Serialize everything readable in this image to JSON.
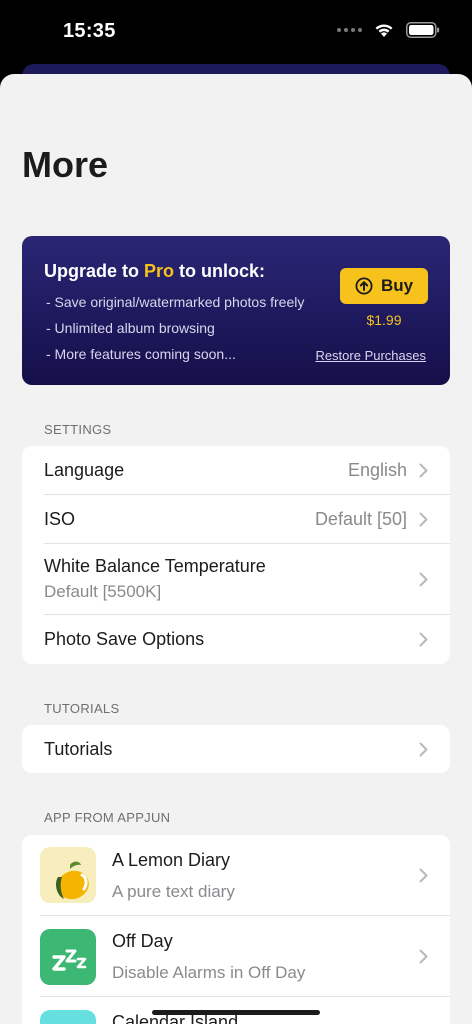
{
  "status": {
    "time": "15:35"
  },
  "page": {
    "title": "More"
  },
  "pro": {
    "heading_pre": "Upgrade to ",
    "heading_pro": "Pro",
    "heading_post": " to unlock:",
    "features": [
      "- Save original/watermarked photos freely",
      "- Unlimited album browsing",
      "- More features coming soon..."
    ],
    "buy_label": "Buy",
    "price": "$1.99",
    "restore_label": "Restore Purchases",
    "accent_color": "#f6c21b",
    "card_color": "#1d1a5c"
  },
  "settings": {
    "header": "SETTINGS",
    "language": {
      "label": "Language",
      "value": "English"
    },
    "iso": {
      "label": "ISO",
      "value": "Default [50]"
    },
    "white_balance": {
      "label": "White Balance Temperature",
      "value": "Default [5500K]"
    },
    "photo_save": {
      "label": "Photo Save Options"
    }
  },
  "tutorials": {
    "header": "TUTORIALS",
    "item": {
      "label": "Tutorials"
    }
  },
  "apps": {
    "header": "APP FROM APPJUN",
    "items": [
      {
        "name": "A Lemon Diary",
        "desc": "A pure text diary",
        "icon": "lemon-icon"
      },
      {
        "name": "Off Day",
        "desc": "Disable Alarms in Off Day",
        "icon": "sleep-zzz-icon"
      },
      {
        "name": "Calendar Island",
        "desc": "",
        "icon": "calendar-island-icon"
      }
    ]
  }
}
